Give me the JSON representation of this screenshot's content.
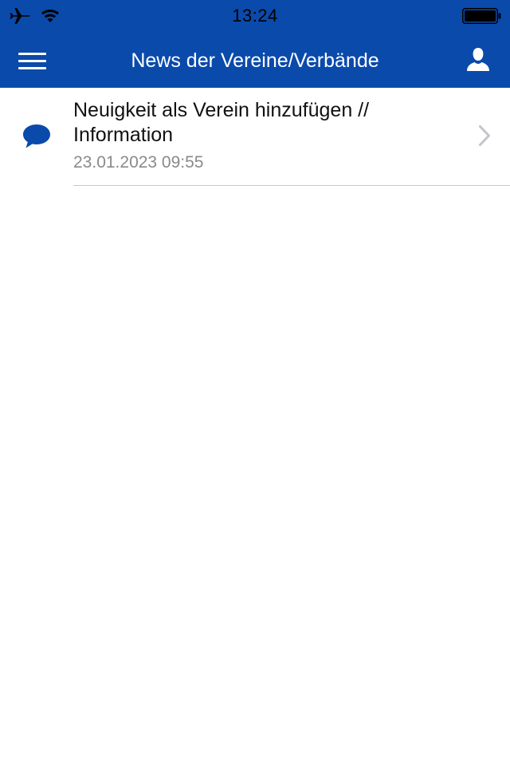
{
  "status_bar": {
    "time": "13:24",
    "icons": [
      "airplane-icon",
      "wifi-icon",
      "battery-icon"
    ]
  },
  "nav_bar": {
    "title": "News der Vereine/Verbände",
    "left_icon": "menu-icon",
    "right_icon": "user-icon",
    "background_color": "#0a4aab"
  },
  "news_list": {
    "items": [
      {
        "icon": "chat-bubble-icon",
        "title": "Neuigkeit als Verein hinzufügen // Information",
        "date": "23.01.2023 09:55"
      }
    ]
  }
}
